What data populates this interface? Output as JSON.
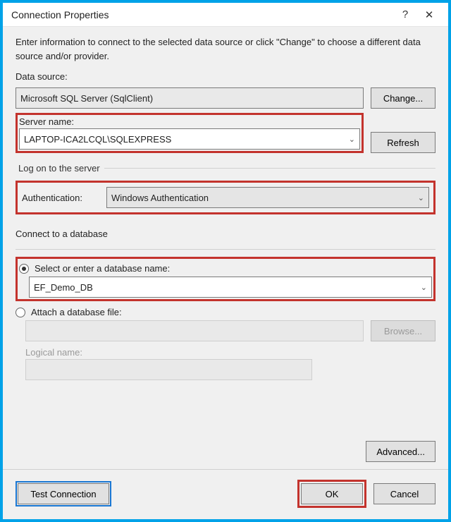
{
  "title": "Connection Properties",
  "help_glyph": "?",
  "close_glyph": "✕",
  "intro": "Enter information to connect to the selected data source or click \"Change\" to choose a different data source and/or provider.",
  "data_source": {
    "label": "Data source:",
    "value": "Microsoft SQL Server (SqlClient)",
    "change_btn": "Change..."
  },
  "server": {
    "label": "Server name:",
    "value": "LAPTOP-ICA2LCQL\\SQLEXPRESS",
    "refresh_btn": "Refresh"
  },
  "logon": {
    "legend": "Log on to the server",
    "auth_label": "Authentication:",
    "auth_value": "Windows Authentication"
  },
  "db": {
    "group_label": "Connect to a database",
    "radio_select_label": "Select or enter a database name:",
    "db_name": "EF_Demo_DB",
    "radio_attach_label": "Attach a database file:",
    "browse_btn": "Browse...",
    "logical_label": "Logical name:"
  },
  "buttons": {
    "advanced": "Advanced...",
    "test": "Test Connection",
    "ok": "OK",
    "cancel": "Cancel"
  }
}
